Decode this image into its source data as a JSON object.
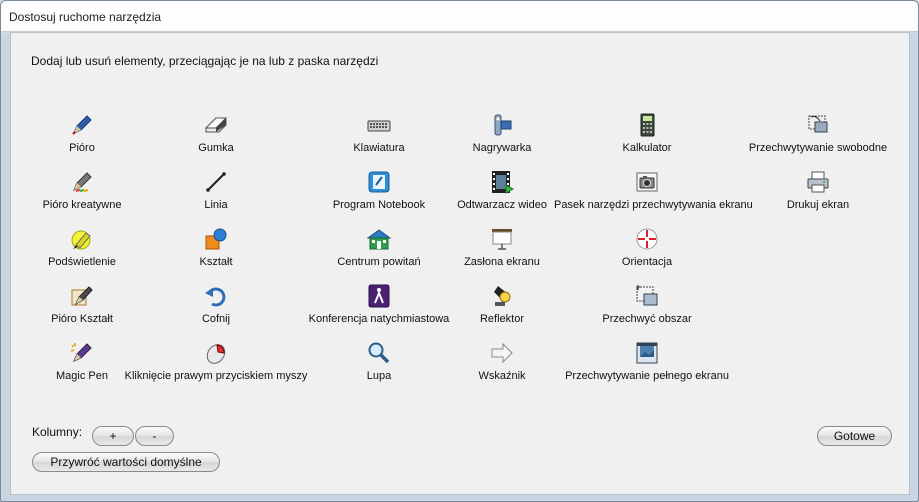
{
  "window": {
    "title": "Dostosuj ruchome narzędzia"
  },
  "instructions": "Dodaj lub usuń elementy, przeciągając je na lub z paska narzędzi",
  "tools": [
    {
      "label": "Pióro",
      "icon": "pen-icon"
    },
    {
      "label": "Gumka",
      "icon": "eraser-icon"
    },
    {
      "label": "Klawiatura",
      "icon": "keyboard-icon"
    },
    {
      "label": "Nagrywarka",
      "icon": "recorder-icon"
    },
    {
      "label": "Kalkulator",
      "icon": "calculator-icon"
    },
    {
      "label": "Przechwytywanie swobodne",
      "icon": "freeform-capture-icon"
    },
    {
      "label": "Pióro kreatywne",
      "icon": "creative-pen-icon"
    },
    {
      "label": "Linia",
      "icon": "line-icon"
    },
    {
      "label": "Program Notebook",
      "icon": "notebook-icon"
    },
    {
      "label": "Odtwarzacz wideo",
      "icon": "video-player-icon"
    },
    {
      "label": "Pasek narzędzi przechwytywania ekranu",
      "icon": "camera-icon"
    },
    {
      "label": "Drukuj ekran",
      "icon": "printer-icon"
    },
    {
      "label": "Podświetlenie",
      "icon": "highlighter-icon"
    },
    {
      "label": "Kształt",
      "icon": "shape-icon"
    },
    {
      "label": "Centrum powitań",
      "icon": "welcome-center-icon"
    },
    {
      "label": "Zasłona ekranu",
      "icon": "screen-shade-icon"
    },
    {
      "label": "Orientacja",
      "icon": "orientation-icon"
    },
    {
      "label": "Pióro Kształt",
      "icon": "shape-pen-icon"
    },
    {
      "label": "Cofnij",
      "icon": "undo-icon"
    },
    {
      "label": "Konferencja natychmiastowa",
      "icon": "conference-icon"
    },
    {
      "label": "Reflektor",
      "icon": "spotlight-icon"
    },
    {
      "label": "Przechwyć obszar",
      "icon": "area-capture-icon"
    },
    {
      "label": "Magic Pen",
      "icon": "magic-pen-icon"
    },
    {
      "label": "Kliknięcie prawym przyciskiem myszy",
      "icon": "right-click-mouse-icon"
    },
    {
      "label": "Lupa",
      "icon": "magnifier-icon"
    },
    {
      "label": "Wskaźnik",
      "icon": "pointer-arrow-icon"
    },
    {
      "label": "Przechwytywanie pełnego ekranu",
      "icon": "fullscreen-capture-icon"
    }
  ],
  "columns": {
    "label": "Kolumny:",
    "plus": "+",
    "minus": "-"
  },
  "buttons": {
    "restore": "Przywróć wartości domyślne",
    "done": "Gotowe"
  }
}
